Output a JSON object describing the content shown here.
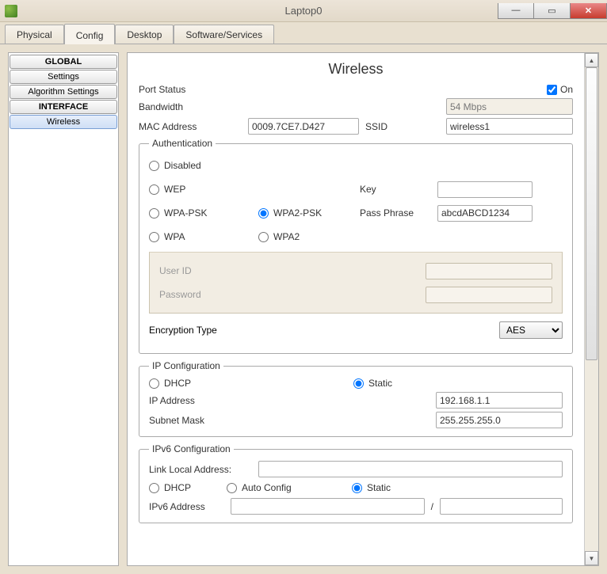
{
  "window": {
    "title": "Laptop0"
  },
  "tabs": {
    "physical": "Physical",
    "config": "Config",
    "desktop": "Desktop",
    "software": "Software/Services"
  },
  "sidebar": {
    "global_header": "GLOBAL",
    "settings": "Settings",
    "algo": "Algorithm Settings",
    "interface_header": "INTERFACE",
    "wireless": "Wireless"
  },
  "panel": {
    "title": "Wireless",
    "port_status_label": "Port Status",
    "on_label": "On",
    "bandwidth_label": "Bandwidth",
    "bandwidth_value": "54 Mbps",
    "mac_label": "MAC Address",
    "mac_value": "0009.7CE7.D427",
    "ssid_label": "SSID",
    "ssid_value": "wireless1",
    "auth": {
      "legend": "Authentication",
      "disabled": "Disabled",
      "wep": "WEP",
      "key_label": "Key",
      "key_value": "",
      "wpa_psk": "WPA-PSK",
      "wpa2_psk": "WPA2-PSK",
      "pass_label": "Pass Phrase",
      "pass_value": "abcdABCD1234",
      "wpa": "WPA",
      "wpa2": "WPA2",
      "userid_label": "User ID",
      "userid_value": "",
      "password_label": "Password",
      "password_value": "",
      "enc_label": "Encryption Type",
      "enc_value": "AES"
    },
    "ip": {
      "legend": "IP Configuration",
      "dhcp": "DHCP",
      "static": "Static",
      "ipaddr_label": "IP Address",
      "ipaddr_value": "192.168.1.1",
      "mask_label": "Subnet Mask",
      "mask_value": "255.255.255.0"
    },
    "ipv6": {
      "legend": "IPv6 Configuration",
      "lla_label": "Link Local Address:",
      "lla_value": "",
      "dhcp": "DHCP",
      "auto": "Auto Config",
      "static": "Static",
      "addr_label": "IPv6 Address",
      "addr_value": "",
      "prefix_sep": "/",
      "prefix_value": ""
    }
  }
}
